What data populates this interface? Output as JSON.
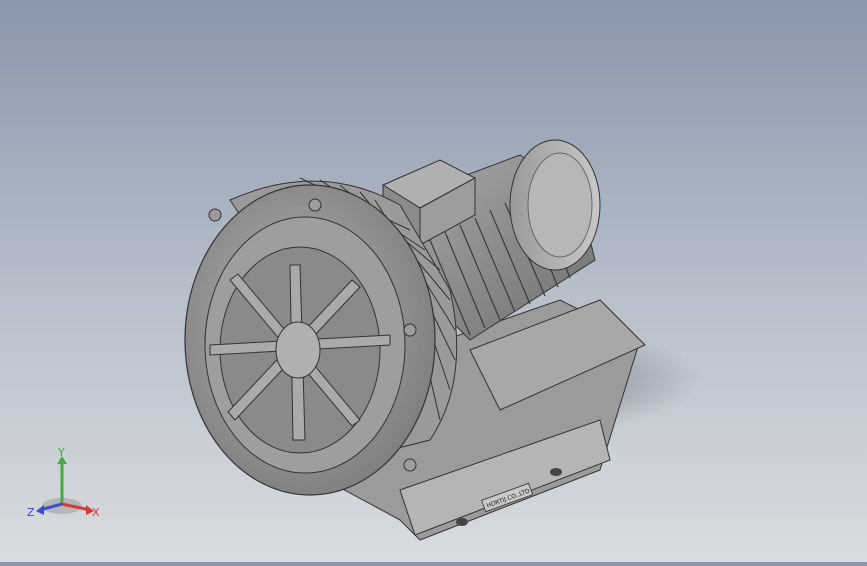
{
  "viewport": {
    "background_top": "#8a97aa",
    "background_bottom": "#d9dce0",
    "model_color": "#8c8c8c",
    "model": "side-channel-blower",
    "nameplate_text": "HORTIJ CO.,LTD"
  },
  "triad": {
    "x_label": "X",
    "y_label": "Y",
    "z_label": "Z",
    "x_color": "#d33c3c",
    "y_color": "#3fae3f",
    "z_color": "#3a4fd0"
  }
}
